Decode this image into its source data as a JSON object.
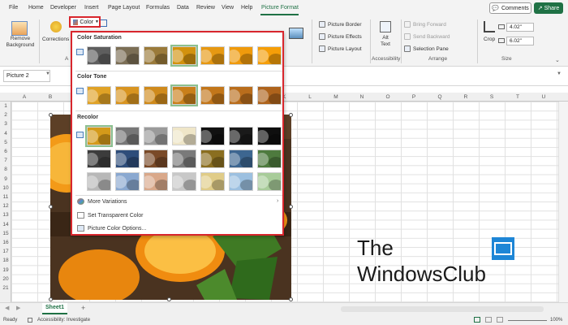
{
  "menu": {
    "tabs": [
      "File",
      "Home",
      "Developer",
      "Insert",
      "Page Layout",
      "Formulas",
      "Data",
      "Review",
      "View",
      "Help",
      "Picture Format"
    ],
    "active_tab": "Picture Format",
    "comments_label": "Comments",
    "share_label": "Share"
  },
  "ribbon": {
    "remove_background": "Remove Background",
    "corrections": "Corrections",
    "color_label": "Color",
    "picture_border": "Picture Border",
    "picture_effects": "Picture Effects",
    "picture_layout": "Picture Layout",
    "alt_text": "Alt Text",
    "accessibility_group": "Accessibility",
    "bring_forward": "Bring Forward",
    "send_backward": "Send Backward",
    "selection_pane": "Selection Pane",
    "arrange_group": "Arrange",
    "crop": "Crop",
    "height_value": "4.02\"",
    "width_value": "6.02\"",
    "size_group": "Size",
    "adjust_group_initial": "A"
  },
  "formula_bar": {
    "name_box": "Picture 2"
  },
  "grid": {
    "columns": [
      "A",
      "B",
      "C",
      "D",
      "E",
      "F",
      "G",
      "H",
      "I",
      "J",
      "K",
      "L",
      "M",
      "N",
      "O",
      "P",
      "Q",
      "R",
      "S",
      "T",
      "U",
      "V"
    ],
    "rows": [
      "1",
      "2",
      "3",
      "4",
      "5",
      "6",
      "7",
      "8",
      "9",
      "10",
      "11",
      "12",
      "13",
      "14",
      "15",
      "16",
      "17",
      "18",
      "19",
      "20",
      "21"
    ]
  },
  "color_menu": {
    "saturation_heading": "Color Saturation",
    "tone_heading": "Color Tone",
    "recolor_heading": "Recolor",
    "more_variations": "More Variations",
    "set_transparent": "Set Transparent Color",
    "picture_color_options": "Picture Color Options...",
    "saturation_thumbs": [
      "#5e5e5e",
      "#7b6e55",
      "#9a7a3a",
      "#d2920e",
      "#e69812",
      "#ef9a0c",
      "#f59e08"
    ],
    "tone_thumbs": [
      "#e0a226",
      "#d89420",
      "#cf8a1c",
      "#c97f1a",
      "#c2761a",
      "#b96d1c",
      "#ae631c"
    ],
    "recolor_row1": [
      "#d49a1a",
      "#777777",
      "#9a9a9a",
      "#efe6c8",
      "#111111",
      "#1a1a1a",
      "#0f0f0f"
    ],
    "recolor_row2": [
      "#3c3c3c",
      "#2e4d7a",
      "#7a4a28",
      "#7a7a7a",
      "#8a6e20",
      "#3d6690",
      "#4e7a3e"
    ],
    "recolor_row3": [
      "#b8b8b8",
      "#8aa8d0",
      "#d9a88a",
      "#c8c8c8",
      "#e0cc88",
      "#9cc0e0",
      "#a8cc9a"
    ]
  },
  "sheet": {
    "tab_label": "Sheet1",
    "add_label": "+"
  },
  "status": {
    "ready": "Ready",
    "accessibility": "Accessibility: Investigate",
    "zoom": "100%"
  },
  "watermark": {
    "line1": "The",
    "line2": "WindowsClub"
  },
  "colors": {
    "accent": "#1f7145",
    "highlight": "#d8262d",
    "selected_outline": "#8dc08f"
  }
}
